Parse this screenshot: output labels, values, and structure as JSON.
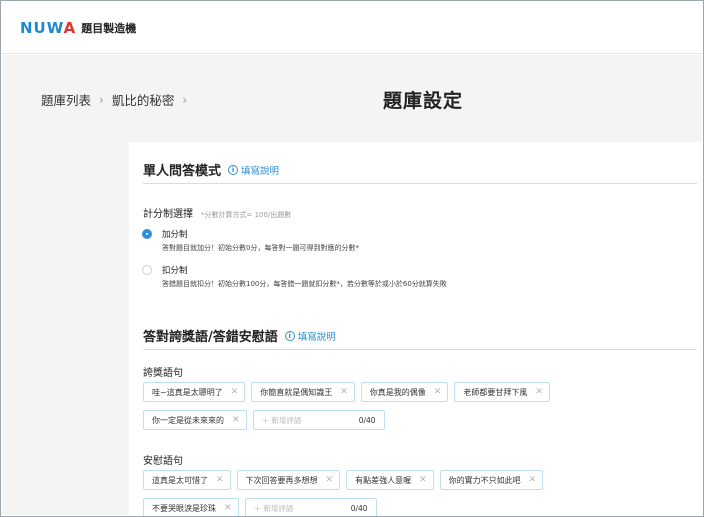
{
  "app": {
    "logo_main": "NUW",
    "logo_accent": "A",
    "name": "題目製造機"
  },
  "breadcrumb": {
    "items": [
      "題庫列表",
      "凱比的秘密"
    ],
    "sep": "›"
  },
  "page_title": "題庫設定",
  "mode_section": {
    "title": "單人問答模式",
    "help": "填寫說明",
    "help_icon": "info-icon",
    "scoring_label": "計分制選擇",
    "scoring_hint": "*分數計算方式= 100/出題數",
    "options": [
      {
        "title": "加分制",
        "desc": "答對題目就加分！初始分數0分，每答對一題可得到對應的分數*",
        "selected": true
      },
      {
        "title": "扣分制",
        "desc": "答錯題目就扣分！初始分數100分，每答錯一題就扣分數*，若分數等於或小於60分就算失敗",
        "selected": false
      }
    ]
  },
  "phrase_section": {
    "title": "答對誇獎語/答錯安慰語",
    "help": "填寫說明",
    "praise_label": "誇獎語句",
    "praise_tags_row1": [
      "哇~這真是太聰明了",
      "你簡直就是偶知識王",
      "你真是我的偶像",
      "老師都要甘拜下風"
    ],
    "praise_tags_row2": [
      "你一定是從未來來的"
    ],
    "praise_input": {
      "placeholder": "＋ 新增評語",
      "count": "0/40"
    },
    "comfort_label": "安慰語句",
    "comfort_tags_row1": [
      "這真是太可惜了",
      "下次回答要再多想想",
      "有點差強人意喔",
      "你的實力不只如此吧"
    ],
    "comfort_tags_row2": [
      "不要哭眼淚是珍珠"
    ],
    "comfort_input": {
      "placeholder": "＋ 新增評語",
      "count": "0/40"
    }
  }
}
